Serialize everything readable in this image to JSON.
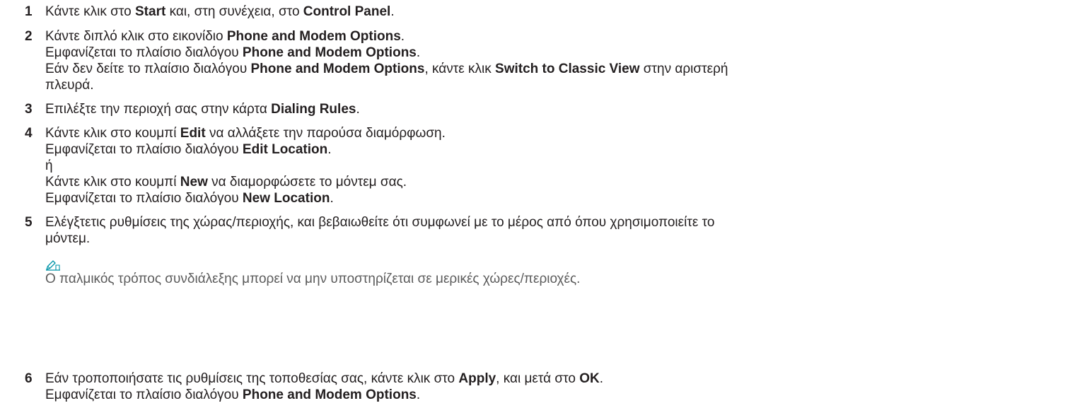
{
  "steps": [
    {
      "number": "1",
      "lines": [
        [
          "Κάντε κλικ στο ",
          {
            "b": "Start"
          },
          " και, στη συνέχεια, στο ",
          {
            "b": "Control Panel"
          },
          "."
        ]
      ]
    },
    {
      "number": "2",
      "lines": [
        [
          "Κάντε διπλό κλικ στο εικονίδιο ",
          {
            "b": "Phone and Modem Options"
          },
          "."
        ],
        [
          "Εμφανίζεται το πλαίσιο διαλόγου ",
          {
            "b": "Phone and Modem Options"
          },
          "."
        ],
        [
          "Εάν δεν δείτε το πλαίσιο διαλόγου ",
          {
            "b": "Phone and Modem Options"
          },
          ", κάντε κλικ ",
          {
            "b": "Switch to Classic View"
          },
          " στην αριστερή"
        ],
        [
          "πλευρά."
        ]
      ]
    },
    {
      "number": "3",
      "lines": [
        [
          "Επιλέξτε την περιοχή σας στην κάρτα ",
          {
            "b": "Dialing Rules"
          },
          "."
        ]
      ]
    },
    {
      "number": "4",
      "lines": [
        [
          "Κάντε κλικ στο κουμπί ",
          {
            "b": "Edit"
          },
          " να αλλάξετε την παρούσα διαμόρφωση."
        ],
        [
          "Εμφανίζεται το πλαίσιο διαλόγου ",
          {
            "b": "Edit Location"
          },
          "."
        ],
        [
          "ή"
        ],
        [
          "Κάντε κλικ στο κουμπί ",
          {
            "b": "New"
          },
          " να διαμορφώσετε το μόντεμ σας."
        ],
        [
          "Εμφανίζεται το πλαίσιο διαλόγου ",
          {
            "b": "New Location"
          },
          "."
        ]
      ]
    },
    {
      "number": "5",
      "lines": [
        [
          "Ελέγξτετις ρυθμίσεις της χώρας/περιοχής, και βεβαιωθείτε ότι συμφωνεί με το μέρος από όπου χρησιμοποιείτε το"
        ],
        [
          "μόντεμ."
        ]
      ],
      "note": {
        "icon": "note-pencil-icon",
        "text": "Ο παλμικός τρόπος συνδιάλεξης μπορεί να μην υποστηρίζεται σε μερικές χώρες/περιοχές."
      }
    },
    {
      "number": "6",
      "lines": [
        [
          "Εάν τροποποιήσατε τις ρυθμίσεις της τοποθεσίας σας, κάντε κλικ στο ",
          {
            "b": "Apply"
          },
          ", και μετά στο ",
          {
            "b": "OK"
          },
          "."
        ],
        [
          "Εμφανίζεται το πλαίσιο διαλόγου ",
          {
            "b": "Phone and Modem Options"
          },
          "."
        ]
      ]
    }
  ],
  "colors": {
    "text": "#231f20",
    "note_text": "#5c5c5c",
    "note_icon": "#0094a8"
  }
}
